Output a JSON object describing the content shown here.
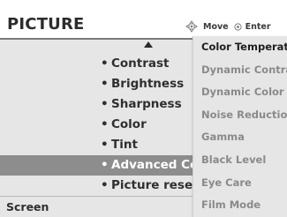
{
  "header": {
    "title": "PICTURE",
    "move_label": "Move",
    "enter_label": "Enter"
  },
  "menu": {
    "items": [
      {
        "label": "Contrast"
      },
      {
        "label": "Brightness"
      },
      {
        "label": "Sharpness"
      },
      {
        "label": "Color"
      },
      {
        "label": "Tint"
      },
      {
        "label": "Advanced Co",
        "selected": true
      },
      {
        "label": "Picture reset"
      }
    ],
    "bullet": "•",
    "screen_label": "Screen"
  },
  "submenu": {
    "items": [
      {
        "label": "Color Temperature",
        "active": true
      },
      {
        "label": "Dynamic Contrast"
      },
      {
        "label": "Dynamic Color"
      },
      {
        "label": "Noise Reduction"
      },
      {
        "label": "Gamma"
      },
      {
        "label": "Black Level"
      },
      {
        "label": "Eye Care"
      },
      {
        "label": "Film Mode"
      }
    ]
  },
  "icons": {
    "move": "dpad-icon",
    "enter": "enter-circle-icon",
    "scroll": "scroll-up-arrow-icon"
  },
  "colors": {
    "panel_bg": "#e6e6e6",
    "selected_bg": "#8d8d8d",
    "text_dark": "#2f2f2f",
    "text_muted": "#8a8a8a"
  }
}
